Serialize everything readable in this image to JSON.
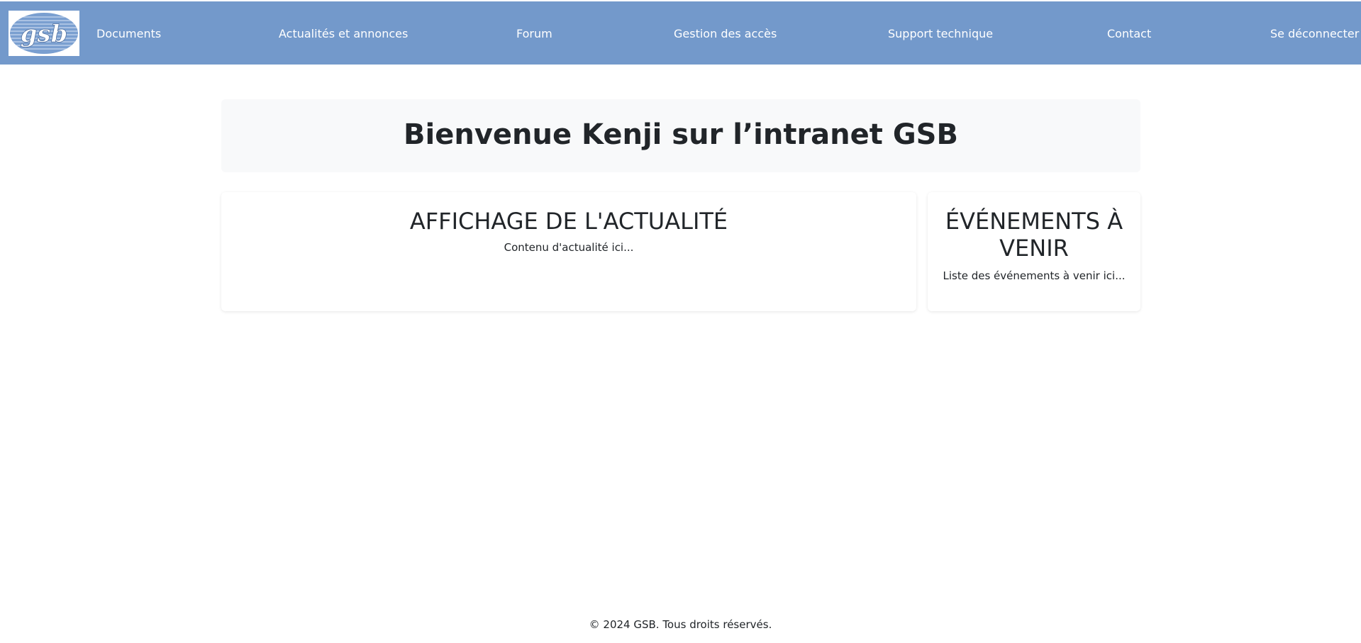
{
  "logo": {
    "text": "gsb",
    "icon": "gsb-logo"
  },
  "nav": {
    "items": [
      {
        "label": "Documents"
      },
      {
        "label": "Actualités et annonces"
      },
      {
        "label": "Forum"
      },
      {
        "label": "Gestion des accès"
      },
      {
        "label": "Support technique"
      },
      {
        "label": "Contact"
      },
      {
        "label": "Se déconnecter"
      }
    ]
  },
  "welcome": {
    "title": "Bienvenue Kenji sur l’intranet GSB"
  },
  "news": {
    "title": "AFFICHAGE DE L'ACTUALITÉ",
    "content": "Contenu d'actualité ici..."
  },
  "events": {
    "title": "ÉVÉNEMENTS À VENIR",
    "content": "Liste des événements à venir ici..."
  },
  "footer": {
    "text": "© 2024 GSB. Tous droits réservés."
  },
  "colors": {
    "navbar": "#7399cb",
    "welcome_bg": "#f8f9fa",
    "text": "#212529"
  }
}
